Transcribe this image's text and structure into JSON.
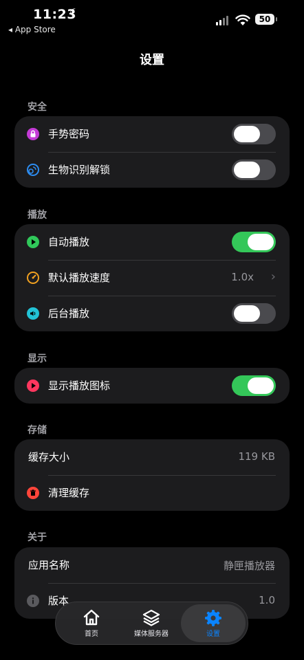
{
  "status_bar": {
    "time": "11:23",
    "back_label": "◂ App Store",
    "battery": "50"
  },
  "header": {
    "title": "设置"
  },
  "sections": {
    "security": {
      "title": "安全",
      "items": [
        {
          "label": "手势密码",
          "toggle": false,
          "icon": "lock-icon"
        },
        {
          "label": "生物识别解锁",
          "toggle": false,
          "icon": "face-id-icon"
        }
      ]
    },
    "playback": {
      "title": "播放",
      "items": [
        {
          "label": "自动播放",
          "toggle": true,
          "icon": "play-icon"
        },
        {
          "label": "默认播放速度",
          "value": "1.0x",
          "icon": "speedometer-icon"
        },
        {
          "label": "后台播放",
          "toggle": false,
          "icon": "speaker-icon"
        }
      ]
    },
    "display": {
      "title": "显示",
      "items": [
        {
          "label": "显示播放图标",
          "toggle": true,
          "icon": "play-icon"
        }
      ]
    },
    "storage": {
      "title": "存储",
      "items": [
        {
          "label": "缓存大小",
          "value": "119 KB"
        },
        {
          "label": "清理缓存",
          "icon": "trash-icon"
        }
      ]
    },
    "about": {
      "title": "关于",
      "items": [
        {
          "label": "应用名称",
          "value": "静匣播放器"
        },
        {
          "label": "版本",
          "value": "1.0",
          "icon": "info-icon"
        }
      ]
    }
  },
  "tabbar": {
    "tabs": [
      {
        "label": "首页",
        "icon": "house-icon",
        "active": false
      },
      {
        "label": "媒体服务器",
        "icon": "layers-icon",
        "active": false
      },
      {
        "label": "设置",
        "icon": "gear-icon",
        "active": true
      }
    ]
  },
  "colors": {
    "accent": "#0a84ff",
    "toggle_on": "#34c759",
    "background": "#000000",
    "card": "#1c1c1e"
  }
}
